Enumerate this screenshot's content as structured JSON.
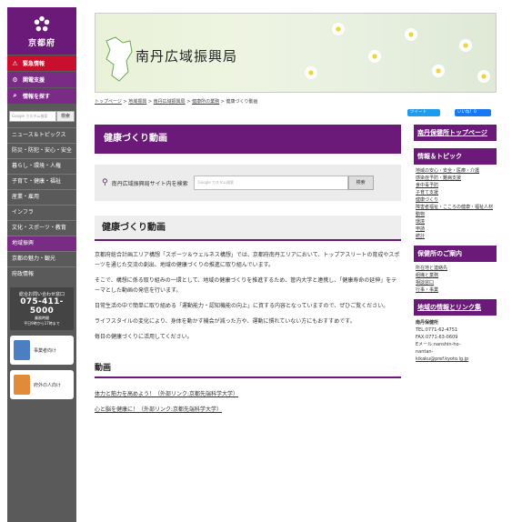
{
  "sidebar": {
    "logo_text": "京都府",
    "emergency": "緊急情報",
    "support": "関電支援",
    "info_search": "情報を探す",
    "search_placeholder": "Google カスタム検索",
    "search_button": "検索",
    "nav": [
      "ニュース＆トピックス",
      "防災・防犯・安心・安全",
      "暮らし・環境・人権",
      "子育て・健康・福祉",
      "産業・雇用",
      "インフラ",
      "文化・スポーツ・教育",
      "地域振興",
      "京都の魅力・観光",
      "府政情報"
    ],
    "contact_label": "総合お問い合わせ窓口",
    "contact_tel": "075-411-5000",
    "contact_hours1": "業務時間",
    "contact_hours2": "平日9時から17時まで",
    "card_business": "事業者向け",
    "card_residents": "府外の人向け"
  },
  "banner": {
    "title": "南丹広域振興局"
  },
  "breadcrumb": [
    "トップページ",
    "地域振興",
    "南丹広域振興局",
    "健康所の業務",
    "健康づくり動画"
  ],
  "social": {
    "tweet": "ツイート",
    "like": "いいね！0"
  },
  "main": {
    "page_title": "健康づくり動画",
    "search_label": "南丹広域振興局サイト内を検索",
    "search_placeholder": "Google カスタム検索",
    "search_button": "検索",
    "section_title": "健康づくり動画",
    "paragraphs": [
      "京都府総合計画エリア構想「スポーツ＆ウェルネス構想」では、京都府南丹エリアにおいて、トップアスリートの育成やスポーツを通じた交流の創出、地域の健康づくりの推進に取り組んでいます。",
      "そこで、構想に係る取り組みの一環として、地域の健康づくりを推進するため、管内大学と連携し、「健康寿命の延伸」をテーマとした動画の発信を行います。",
      "日常生活の中で簡単に取り組める「運動能力・認知機能の向上」に資する内容となっていますので、ぜひご覧ください。",
      "ライフスタイルの変化により、身体を動かす機会が減った方や、運動に慣れていない方にもおすすめです。",
      "毎日の健康づくりに活用してください。"
    ],
    "video_heading": "動画",
    "links": [
      "体力と筋力を高めよう！（外部リンク:京都先端科学大学）",
      "心と脳を健康に！（外部リンク:京都先端科学大学）"
    ]
  },
  "right": {
    "top_link": "南丹保健所トップページ",
    "topics_title": "情報＆トピック",
    "topics": [
      "地域の安心・安全・医療・介護",
      "感染症予防・難病支援",
      "食中毒予防",
      "子育て支援",
      "健康づくり",
      "障害者福祉・こころの健康・福祉人材",
      "動物",
      "環境",
      "申請",
      "統計"
    ],
    "guide_title": "保健所のご案内",
    "guide": [
      "所在地と連絡先",
      "組織と業務",
      "相談窓口",
      "行事・事業"
    ],
    "region_title": "地域の情報とリンク集",
    "office_name": "南丹保健所",
    "tel": "TEL:0771-62-4751",
    "fax": "FAX:0771-63-0609",
    "email_label": "Eメール:nanshin-ho-",
    "email2": "nantan-",
    "email3": "kikaku@pref.kyoto.lg.jp"
  },
  "colors": {
    "brand": "#6b1a7a",
    "emergency": "#c8102e",
    "sidebar": "#5a5a5a"
  }
}
